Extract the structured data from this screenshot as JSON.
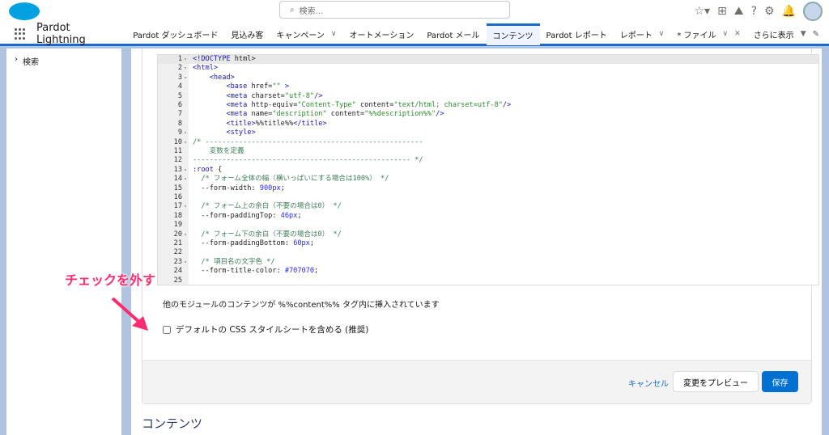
{
  "header": {
    "search_placeholder": "検索...",
    "brand_color": "#00a1e0"
  },
  "nav": {
    "app_name": "Pardot Lightning",
    "tabs": [
      {
        "label": "Pardot ダッシュボード"
      },
      {
        "label": "見込み客"
      },
      {
        "label": "キャンペーン",
        "chevron": true
      },
      {
        "label": "オートメーション"
      },
      {
        "label": "Pardot メール"
      },
      {
        "label": "コンテンツ",
        "active": true
      },
      {
        "label": "Pardot レポート"
      },
      {
        "label": "レポート",
        "chevron": true
      },
      {
        "label": "* ファイル",
        "chevron": true,
        "close": true
      },
      {
        "label": "さらに表示",
        "more": true
      }
    ]
  },
  "sidebar": {
    "search_label": "検索"
  },
  "editor": {
    "lines": [
      [
        [
          "t",
          "<!DOCTYPE"
        ],
        [
          "p",
          " html>"
        ]
      ],
      [
        [
          "t",
          "<html>"
        ]
      ],
      [
        [
          "p",
          "    "
        ],
        [
          "t",
          "<head>"
        ]
      ],
      [
        [
          "p",
          "        "
        ],
        [
          "t",
          "<base"
        ],
        [
          "p",
          " href="
        ],
        [
          "s",
          "\"\""
        ],
        [
          "t",
          " >"
        ]
      ],
      [
        [
          "p",
          "        "
        ],
        [
          "t",
          "<meta"
        ],
        [
          "p",
          " charset="
        ],
        [
          "s",
          "\"utf-8\""
        ],
        [
          "t",
          "/>"
        ]
      ],
      [
        [
          "p",
          "        "
        ],
        [
          "t",
          "<meta"
        ],
        [
          "p",
          " http-equiv="
        ],
        [
          "s",
          "\"Content-Type\""
        ],
        [
          "p",
          " content="
        ],
        [
          "s",
          "\"text/html; charset=utf-8\""
        ],
        [
          "t",
          "/>"
        ]
      ],
      [
        [
          "p",
          "        "
        ],
        [
          "t",
          "<meta"
        ],
        [
          "p",
          " name="
        ],
        [
          "s",
          "\"description\""
        ],
        [
          "p",
          " content="
        ],
        [
          "s",
          "\"%%description%%\""
        ],
        [
          "t",
          "/>"
        ]
      ],
      [
        [
          "p",
          "        "
        ],
        [
          "t",
          "<title>"
        ],
        [
          "p",
          "%%title%%"
        ],
        [
          "t",
          "</title>"
        ]
      ],
      [
        [
          "p",
          "        "
        ],
        [
          "t",
          "<style>"
        ]
      ],
      [
        [
          "c",
          "/* ----------------------------------------------------"
        ]
      ],
      [
        [
          "c",
          "    変数を定義"
        ]
      ],
      [
        [
          "c",
          "---------------------------------------------------- */"
        ]
      ],
      [
        [
          "t",
          ":root"
        ],
        [
          "p",
          " {"
        ]
      ],
      [
        [
          "c",
          "  /* フォーム全体の幅（横いっぱいにする場合は100%） */"
        ]
      ],
      [
        [
          "p",
          "  --form-width: "
        ],
        [
          "n",
          "900px"
        ],
        [
          "p",
          ";"
        ]
      ],
      [],
      [
        [
          "c",
          "  /* フォーム上の余白（不要の場合は0） */"
        ]
      ],
      [
        [
          "p",
          "  --form-paddingTop: "
        ],
        [
          "n",
          "46px"
        ],
        [
          "p",
          ";"
        ]
      ],
      [],
      [
        [
          "c",
          "  /* フォーム下の余白（不要の場合は0） */"
        ]
      ],
      [
        [
          "p",
          "  --form-paddingBottom: "
        ],
        [
          "n",
          "60px"
        ],
        [
          "p",
          ";"
        ]
      ],
      [],
      [
        [
          "c",
          "  /* 項目名の文字色 */"
        ]
      ],
      [
        [
          "p",
          "  --form-title-color: "
        ],
        [
          "n",
          "#707070"
        ],
        [
          "p",
          ";"
        ]
      ],
      []
    ],
    "fold_lines": [
      1,
      2,
      3,
      9,
      10,
      13,
      14,
      17,
      20,
      23
    ]
  },
  "info_text": "他のモジュールのコンテンツが %%content%% タグ内に挿入されています",
  "checkbox": {
    "label": "デフォルトの CSS スタイルシートを含める (推奨)",
    "checked": false
  },
  "footer": {
    "cancel": "キャンセル",
    "preview": "変更をプレビュー",
    "save": "保存"
  },
  "section_title": "コンテンツ",
  "annotation": {
    "text": "チェックを外す",
    "color": "#ff2d6f"
  }
}
